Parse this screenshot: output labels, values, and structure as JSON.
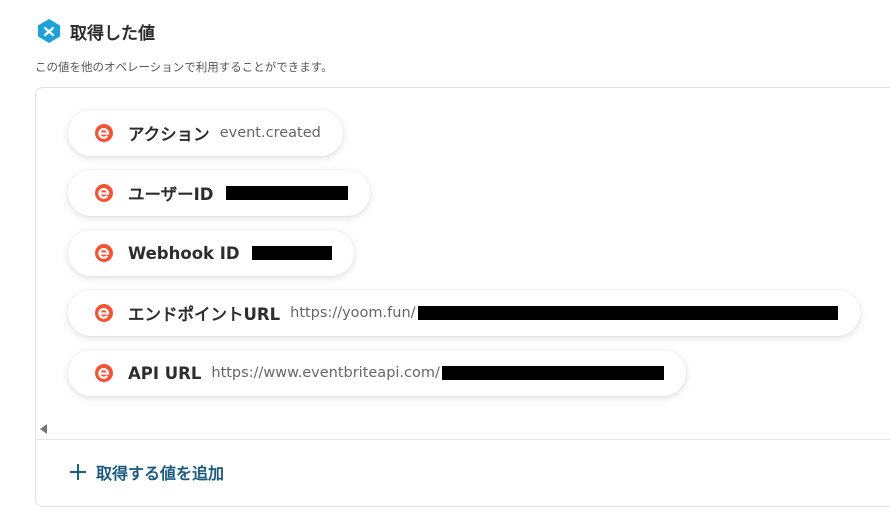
{
  "header": {
    "title": "取得した値",
    "description": "この値を他のオペレーションで利用することができます。"
  },
  "values": [
    {
      "label": "アクション",
      "value": "event.created"
    },
    {
      "label": "ユーザーID",
      "value": ""
    },
    {
      "label": "Webhook ID",
      "value": ""
    },
    {
      "label": "エンドポイントURL",
      "value": "https://yoom.fun/"
    },
    {
      "label": "API URL",
      "value": "https://www.eventbriteapi.com/"
    }
  ],
  "add_button": {
    "label": "取得する値を追加"
  },
  "colors": {
    "accent": "#1d5a80",
    "brand_logo": "#f05537",
    "header_icon": "#1da1d8"
  }
}
